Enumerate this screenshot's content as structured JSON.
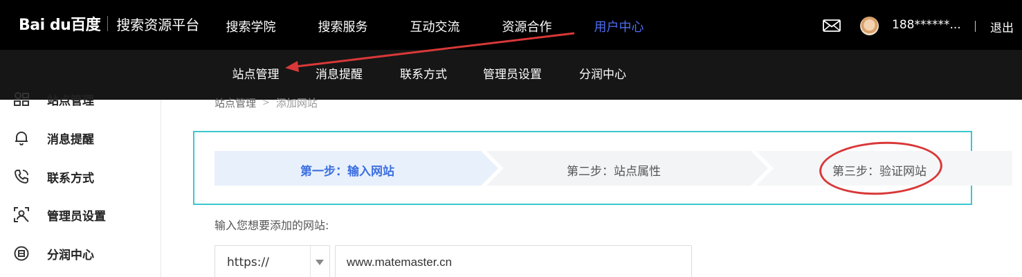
{
  "header": {
    "logo_text": "Bai du百度",
    "platform_title": "搜索资源平台",
    "nav": [
      {
        "label": "搜索学院",
        "active": false
      },
      {
        "label": "搜索服务",
        "active": false
      },
      {
        "label": "互动交流",
        "active": false
      },
      {
        "label": "资源合作",
        "active": false
      },
      {
        "label": "用户中心",
        "active": true
      }
    ],
    "user_name": "188******...",
    "logout_label": "退出",
    "active_color": "#4e6ef2",
    "icons": {
      "mail": "mail-icon",
      "avatar": "avatar"
    }
  },
  "subnav": {
    "items": [
      "站点管理",
      "消息提醒",
      "联系方式",
      "管理员设置",
      "分润中心"
    ]
  },
  "sidebar": {
    "items": [
      {
        "label": "站点管理",
        "icon": "site-manage-icon"
      },
      {
        "label": "消息提醒",
        "icon": "bell-icon"
      },
      {
        "label": "联系方式",
        "icon": "phone-icon"
      },
      {
        "label": "管理员设置",
        "icon": "admin-settings-icon"
      },
      {
        "label": "分润中心",
        "icon": "revenue-share-icon"
      }
    ]
  },
  "breadcrumb": {
    "root": "站点管理",
    "current": "添加网站"
  },
  "steps": [
    {
      "label": "第一步：输入网站",
      "active": true
    },
    {
      "label": "第二步：站点属性",
      "active": false
    },
    {
      "label": "第三步：验证网站",
      "active": false
    }
  ],
  "form": {
    "prompt": "输入您想要添加的网站:",
    "protocol": "https://",
    "url_value": "www.matemaster.cn"
  },
  "colors": {
    "accent_blue": "#3c6fe0",
    "highlight_border": "#39c7cf",
    "annotation_red": "#d93838"
  }
}
